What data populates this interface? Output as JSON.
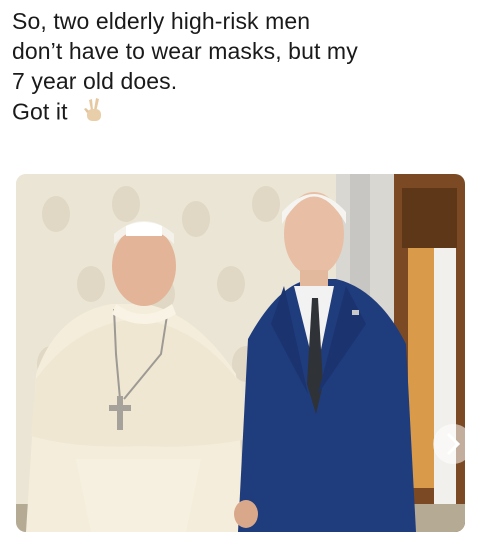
{
  "caption": {
    "line1": "So, two elderly high-risk men",
    "line2": "don’t have to wear masks, but my",
    "line3": "7 year old does.",
    "line4": "Got it",
    "emoji": "peace-hand-icon"
  },
  "photo": {
    "subject": "photo-two-men",
    "colors": {
      "wall": "#ece6d6",
      "robe": "#f3ecd7",
      "suit": "#1e3a7a",
      "door": "#7a4a24"
    }
  }
}
